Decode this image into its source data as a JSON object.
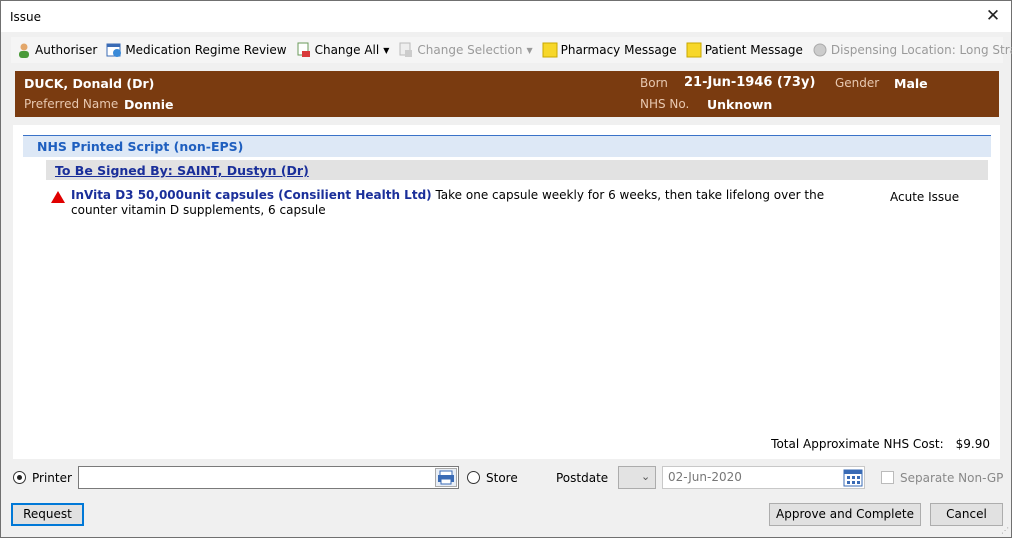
{
  "window": {
    "title": "Issue",
    "close_glyph": "✕"
  },
  "toolbar": {
    "authoriser": "Authoriser",
    "medication_regime_review": "Medication Regime Review",
    "change_all": "Change All",
    "change_selection": "Change Selection",
    "pharmacy_message": "Pharmacy Message",
    "patient_message": "Patient Message",
    "dispensing_location": "Dispensing Location: Long Stratton"
  },
  "patient": {
    "name": "DUCK, Donald (Dr)",
    "preferred_name_label": "Preferred Name",
    "preferred_name": "Donnie",
    "born_label": "Born",
    "born": "21-Jun-1946 (73y)",
    "gender_label": "Gender",
    "gender": "Male",
    "nhs_label": "NHS No.",
    "nhs": "Unknown",
    "banner_color": "#7a3b10"
  },
  "script": {
    "header": "NHS Printed Script (non-EPS)",
    "signed_by": "To Be Signed By: SAINT, Dustyn (Dr)",
    "items": [
      {
        "drug": "InVita D3 50,000unit capsules (Consilient Health Ltd)",
        "dosage": " Take one capsule weekly for 6 weeks, then take lifelong over the counter vitamin D supplements, 6 capsule",
        "issue_type": "Acute Issue",
        "warning_color": "#e00000"
      }
    ]
  },
  "total": {
    "label": "Total Approximate NHS Cost:",
    "amount": "$9.90"
  },
  "output": {
    "printer_label": "Printer",
    "printer_value": "",
    "store_label": "Store",
    "postdate_label": "Postdate",
    "postdate_value": "02-Jun-2020",
    "separate_non_gp_label": "Separate Non-GP"
  },
  "buttons": {
    "request": "Request",
    "approve_complete": "Approve and Complete",
    "cancel": "Cancel"
  }
}
